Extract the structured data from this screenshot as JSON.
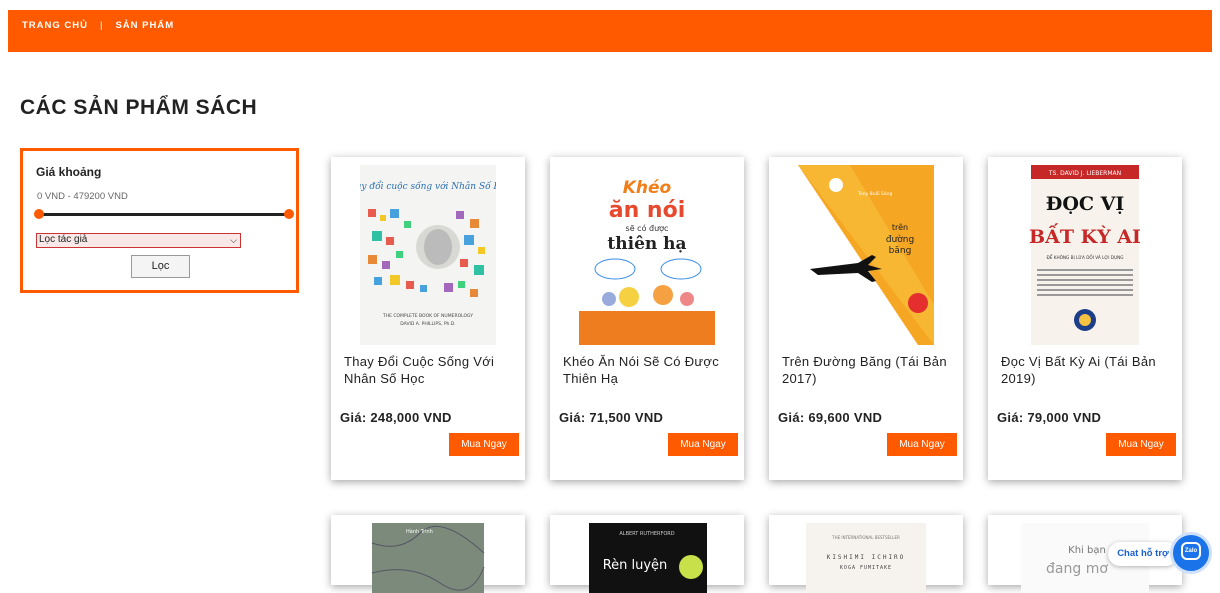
{
  "nav": {
    "home": "TRANG CHỦ",
    "separator": "|",
    "products": "SẢN PHẨM"
  },
  "page_title": "CÁC SẢN PHẨM SÁCH",
  "filter": {
    "label": "Giá khoảng",
    "range_text": "0 VND - 479200 VND",
    "author_select": "Lọc tác giả",
    "button": "Lọc"
  },
  "products": [
    {
      "title": "Thay Đổi Cuộc Sống Với Nhân Số Học",
      "price": "Giá: 248,000 VND",
      "buy": "Mua Ngay",
      "cover_title": "Thay đổi cuộc sống với Nhân Số Học",
      "cover_sub": "THE COMPLETE BOOK OF NUMEROLOGY",
      "cover_author": "DAVID A. PHILLIPS, Ph.D."
    },
    {
      "title": "Khéo Ăn Nói Sẽ Có Được Thiên Hạ",
      "price": "Giá: 71,500 VND",
      "buy": "Mua Ngay",
      "cover_l1": "Khéo",
      "cover_l2": "ăn nói",
      "cover_l3": "sẽ có được",
      "cover_l4": "thiên hạ"
    },
    {
      "title": "Trên Đường Băng (Tái Bản 2017)",
      "price": "Giá: 69,600 VND",
      "buy": "Mua Ngay",
      "cover_l1": "trên",
      "cover_l2": "đường",
      "cover_l3": "băng",
      "cover_brand": "Tony Buổi Sáng"
    },
    {
      "title": "Đọc Vị Bất Kỳ Ai (Tái Bản 2019)",
      "price": "Giá: 79,000 VND",
      "buy": "Mua Ngay",
      "cover_author": "TS. DAVID J. LIEBERMAN",
      "cover_l1": "ĐỌC VỊ",
      "cover_l2": "BẤT KỲ AI",
      "cover_sub": "ĐỂ KHÔNG BỊ LỪA DỐI VÀ LỢI DỤNG"
    }
  ],
  "products_row2": [
    {
      "cover_text": "Hành Trình"
    },
    {
      "cover_author": "ALBERT RUTHERFORD",
      "cover_text": "Rèn luyện"
    },
    {
      "cover_top": "THE INTERNATIONAL BESTSELLER",
      "cover_text": "KISHIMI ICHIRO",
      "cover_text2": "KOGA FUMITAKE"
    },
    {
      "cover_text": "Khi bạn",
      "cover_text2": "đang mơ"
    }
  ],
  "chat": {
    "label": "Chat hỗ trợ",
    "zalo": "Zalo"
  },
  "colors": {
    "accent": "#ff5a00",
    "chat_blue": "#1a73e8"
  }
}
